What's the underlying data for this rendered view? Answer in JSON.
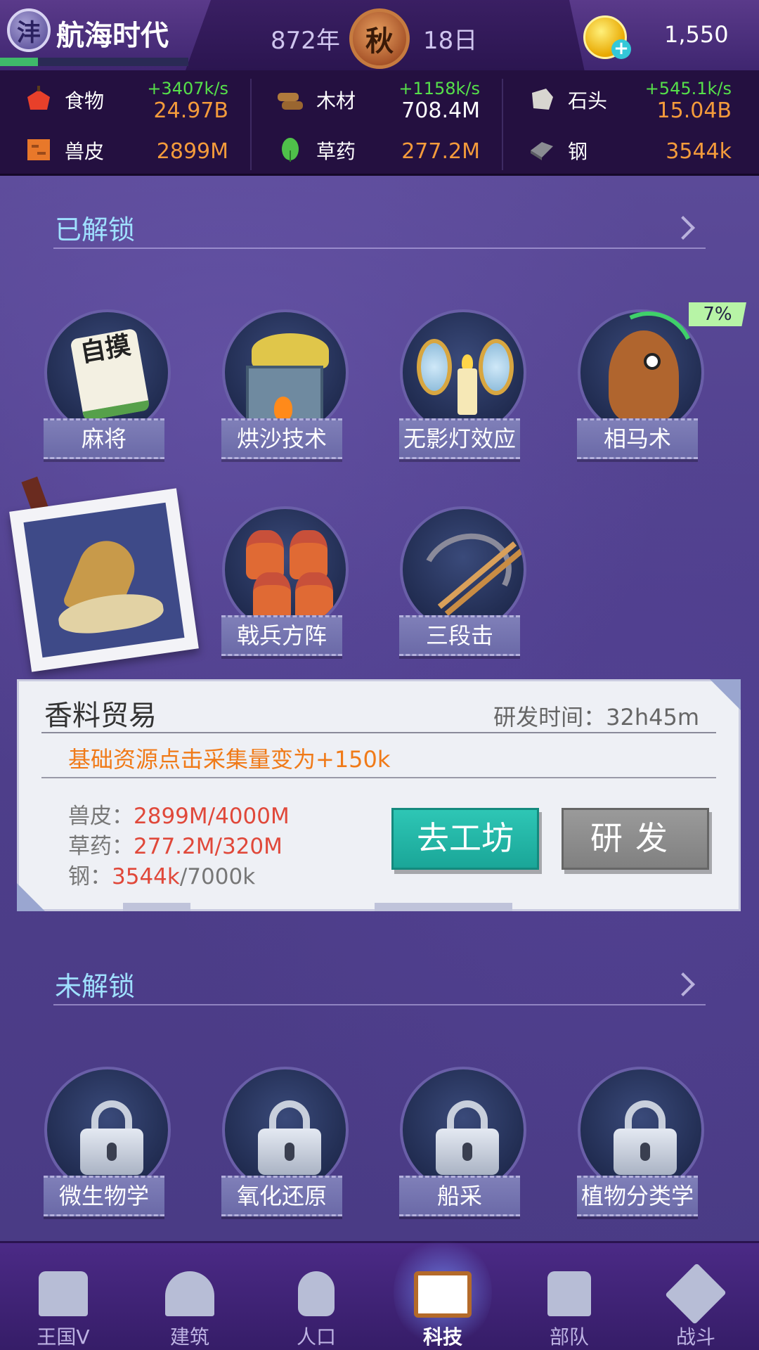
{
  "header": {
    "logo_glyph": "沣",
    "game_title": "航海时代",
    "title_progress_fraction": 0.2,
    "year": "872年",
    "season": "秋",
    "day": "18日",
    "coins": "1,550",
    "coin_plus": "+"
  },
  "resources": [
    {
      "name": "食物",
      "icon": "apple-icon",
      "rate": "+3407k/s",
      "value": "24.97B"
    },
    {
      "name": "木材",
      "icon": "wood-icon",
      "rate": "+1158k/s",
      "value": "708.4M"
    },
    {
      "name": "石头",
      "icon": "stone-icon",
      "rate": "+545.1k/s",
      "value": "15.04B"
    },
    {
      "name": "兽皮",
      "icon": "hide-icon",
      "rate": "",
      "value": "2899M"
    },
    {
      "name": "草药",
      "icon": "herb-icon",
      "rate": "",
      "value": "277.2M"
    },
    {
      "name": "钢",
      "icon": "steel-icon",
      "rate": "",
      "value": "3544k"
    }
  ],
  "unlocked": {
    "title": "已解锁",
    "items": [
      {
        "label": "麻将",
        "art_text": "自摸"
      },
      {
        "label": "烘沙技术"
      },
      {
        "label": "无影灯效应"
      },
      {
        "label": "相马术",
        "progress": "7%"
      },
      {
        "label": "戟兵方阵"
      },
      {
        "label": "三段击"
      }
    ]
  },
  "detail": {
    "name": "香料贸易",
    "research_time": "研发时间：32h45m",
    "effect": "基础资源点击采集量变为+150k",
    "requirements": [
      {
        "label": "兽皮：",
        "have": "2899M/4000M",
        "need": ""
      },
      {
        "label": "草药：",
        "have": "277.2M/320M",
        "need": ""
      },
      {
        "label": "钢：",
        "have": "3544k",
        "need": "/7000k"
      }
    ],
    "workshop_button": "去工坊",
    "research_button": "研发"
  },
  "locked": {
    "title": "未解锁",
    "items": [
      {
        "label": "微生物学"
      },
      {
        "label": "氧化还原"
      },
      {
        "label": "船采"
      },
      {
        "label": "植物分类学"
      }
    ]
  },
  "nav": [
    {
      "label": "王国V",
      "icon": "castle-icon"
    },
    {
      "label": "建筑",
      "icon": "house-icon"
    },
    {
      "label": "人口",
      "icon": "person-icon"
    },
    {
      "label": "科技",
      "icon": "book-icon",
      "active": true
    },
    {
      "label": "部队",
      "icon": "banner-icon"
    },
    {
      "label": "战斗",
      "icon": "swords-icon"
    }
  ],
  "colors": {
    "rate_green": "#56e04a",
    "value_orange": "#f49b3b",
    "section_title": "#9fe0ff",
    "effect_orange": "#f07a18",
    "have_red": "#e0483a",
    "workshop_teal": "#2ec6b5",
    "research_gray": "#8a8a8a"
  }
}
